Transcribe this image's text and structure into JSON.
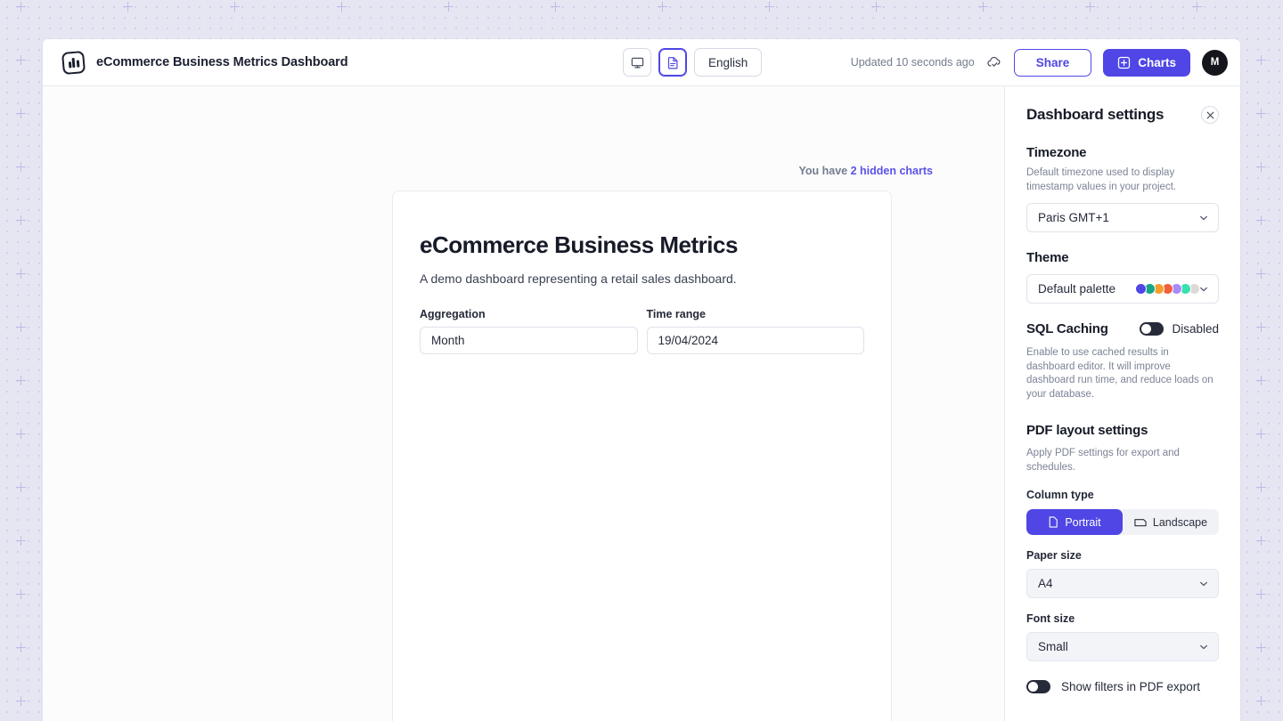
{
  "topbar": {
    "logo_icon": "chart-logo-icon",
    "title": "eCommerce Business Metrics Dashboard",
    "view_desktop_icon": "monitor-icon",
    "view_document_icon": "document-icon",
    "language_label": "English",
    "updated_text": "Updated 10 seconds ago",
    "cloud_icon": "cloud-check-icon",
    "share_label": "Share",
    "charts_label": "Charts",
    "charts_icon": "plus-square-icon",
    "avatar_initial": "M"
  },
  "canvas": {
    "hidden_prefix": "You have ",
    "hidden_link": "2 hidden charts",
    "dashboard": {
      "title": "eCommerce Business Metrics",
      "subtitle": "A demo dashboard representing a retail sales dashboard.",
      "filters": [
        {
          "label": "Aggregation",
          "value": "Month"
        },
        {
          "label": "Time range",
          "value": "19/04/2024"
        }
      ]
    }
  },
  "panel": {
    "title": "Dashboard settings",
    "close_icon": "close-icon",
    "timezone": {
      "heading": "Timezone",
      "description": "Default timezone used to display timestamp values in your project.",
      "value": "Paris GMT+1",
      "chevron_icon": "chevron-down-icon"
    },
    "theme": {
      "heading": "Theme",
      "value": "Default palette",
      "chevron_icon": "chevron-down-icon",
      "palette": [
        "#4f46e5",
        "#16a789",
        "#f59e2c",
        "#f2603c",
        "#a78bfa",
        "#38e1ae",
        "#ded9d8"
      ]
    },
    "sql_caching": {
      "heading": "SQL Caching",
      "toggle_state": "Disabled",
      "description": "Enable to use cached results in dashboard editor. It will improve dashboard run time, and reduce loads on your database."
    },
    "pdf": {
      "heading": "PDF layout settings",
      "description": "Apply PDF settings for export and schedules.",
      "column_type_label": "Column type",
      "portrait_label": "Portrait",
      "portrait_icon": "page-portrait-icon",
      "landscape_label": "Landscape",
      "landscape_icon": "page-landscape-icon",
      "paper_size_label": "Paper size",
      "paper_size_value": "A4",
      "font_size_label": "Font size",
      "font_size_value": "Small",
      "show_filters_label": "Show filters in PDF export"
    }
  },
  "colors": {
    "accent": "#4f46e5",
    "surface": "#e6e6f2",
    "text": "#171b28"
  }
}
